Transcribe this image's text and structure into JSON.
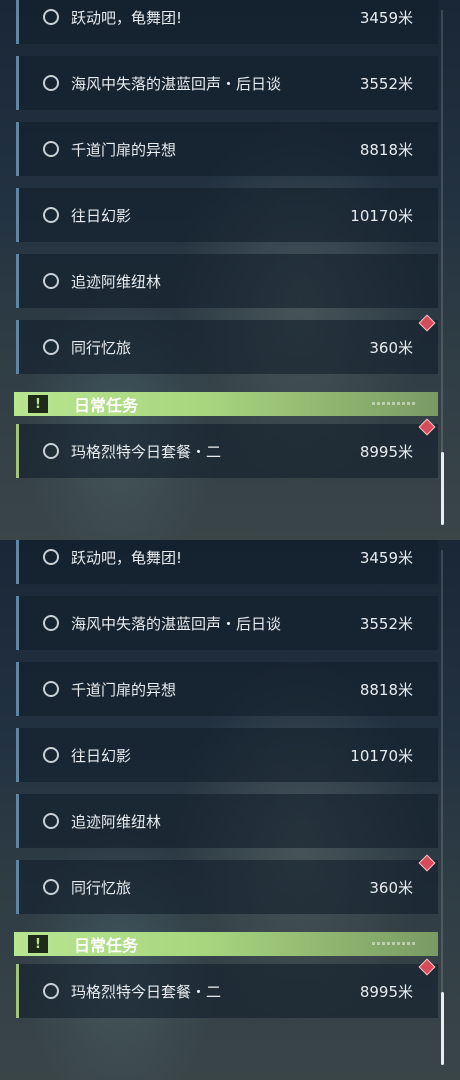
{
  "panels": [
    {
      "quests": [
        {
          "name": "跃动吧，龟舞团!",
          "distance": "3459米"
        },
        {
          "name": "海风中失落的湛蓝回声・后日谈",
          "distance": "3552米"
        },
        {
          "name": "千道门扉的异想",
          "distance": "8818米"
        },
        {
          "name": "往日幻影",
          "distance": "10170米"
        },
        {
          "name": "追迹阿维纽林",
          "distance": ""
        },
        {
          "name": "同行忆旅",
          "distance": "360米"
        }
      ],
      "section": {
        "title": "日常任务",
        "badge": "!"
      },
      "daily_quest": {
        "name": "玛格烈特今日套餐・二",
        "distance": "8995米"
      }
    },
    {
      "quests": [
        {
          "name": "跃动吧，龟舞团!",
          "distance": "3459米"
        },
        {
          "name": "海风中失落的湛蓝回声・后日谈",
          "distance": "3552米"
        },
        {
          "name": "千道门扉的异想",
          "distance": "8818米"
        },
        {
          "name": "往日幻影",
          "distance": "10170米"
        },
        {
          "name": "追迹阿维纽林",
          "distance": ""
        },
        {
          "name": "同行忆旅",
          "distance": "360米"
        }
      ],
      "section": {
        "title": "日常任务",
        "badge": "!"
      },
      "daily_quest": {
        "name": "玛格烈特今日套餐・二",
        "distance": "8995米"
      }
    }
  ]
}
